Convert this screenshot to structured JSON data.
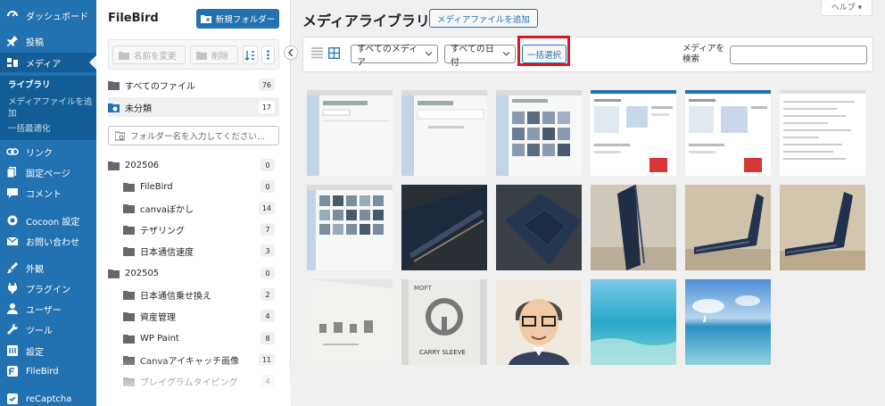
{
  "admin_menu": {
    "items": [
      {
        "label": "ダッシュボード",
        "icon": "dashboard-icon"
      },
      {
        "label": "投稿",
        "icon": "pin-icon"
      },
      {
        "label": "メディア",
        "icon": "media-icon",
        "active": true
      },
      {
        "label": "リンク",
        "icon": "link-icon"
      },
      {
        "label": "固定ページ",
        "icon": "page-icon"
      },
      {
        "label": "コメント",
        "icon": "comment-icon"
      },
      {
        "label": "Cocoon 設定",
        "icon": "cocoon-icon"
      },
      {
        "label": "お問い合わせ",
        "icon": "mail-icon"
      },
      {
        "label": "外観",
        "icon": "appearance-icon"
      },
      {
        "label": "プラグイン",
        "icon": "plugin-icon"
      },
      {
        "label": "ユーザー",
        "icon": "user-icon"
      },
      {
        "label": "ツール",
        "icon": "tool-icon"
      },
      {
        "label": "設定",
        "icon": "settings-icon"
      },
      {
        "label": "FileBird",
        "icon": "filebird-icon"
      },
      {
        "label": "reCaptcha",
        "icon": "recaptcha-icon"
      }
    ],
    "submenu": [
      "ライブラリ",
      "メディアファイルを追加",
      "一括最適化"
    ]
  },
  "filebird": {
    "title": "FileBird",
    "new_folder": "新規フォルダー",
    "rename": "名前を変更",
    "delete": "削除",
    "all_files": {
      "label": "すべてのファイル",
      "count": "76"
    },
    "uncategorized": {
      "label": "未分類",
      "count": "17"
    },
    "search_placeholder": "フォルダー名を入力してください...",
    "folders": [
      {
        "label": "202506",
        "count": "0",
        "level": 0
      },
      {
        "label": "FileBird",
        "count": "0",
        "level": 1
      },
      {
        "label": "canvaぼかし",
        "count": "14",
        "level": 1
      },
      {
        "label": "テザリング",
        "count": "7",
        "level": 1
      },
      {
        "label": "日本通信速度",
        "count": "3",
        "level": 1
      },
      {
        "label": "202505",
        "count": "0",
        "level": 0
      },
      {
        "label": "日本通信乗せ換え",
        "count": "2",
        "level": 1
      },
      {
        "label": "資産管理",
        "count": "4",
        "level": 1
      },
      {
        "label": "WP Paint",
        "count": "8",
        "level": 1
      },
      {
        "label": "Canvaアイキャッチ画像",
        "count": "11",
        "level": 1
      },
      {
        "label": "ブレイグラムタイピング",
        "count": "4",
        "level": 1
      }
    ]
  },
  "main": {
    "title": "メディアライブラリ",
    "add_media": "メディアファイルを追加",
    "help": "ヘルプ ▾",
    "filter_type": "すべてのメディア",
    "filter_date": "すべての日付",
    "bulk_select": "一括選択",
    "search_label": "メディアを検索"
  },
  "colors": {
    "admin_blue": "#2271b1",
    "admin_blue_dark": "#135e96",
    "highlight_red": "#e0141e"
  }
}
